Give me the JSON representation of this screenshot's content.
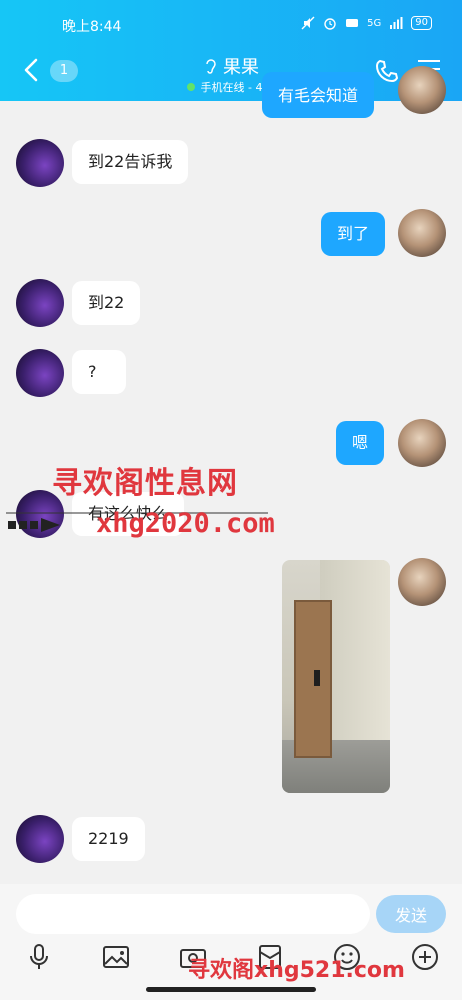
{
  "status_bar": {
    "time": "晚上8:44",
    "battery": "90",
    "network": "5G"
  },
  "header": {
    "unread_count": "1",
    "contact_name": "果果",
    "presence": "手机在线 - 4G",
    "presence_chevron": "›"
  },
  "messages": [
    {
      "side": "out",
      "text": "有毛会知道"
    },
    {
      "side": "in",
      "text": "到22告诉我"
    },
    {
      "side": "out",
      "text": "到了"
    },
    {
      "side": "in",
      "text": "到22"
    },
    {
      "side": "in",
      "text": "?"
    },
    {
      "side": "out",
      "text": "嗯"
    },
    {
      "side": "in",
      "text": "有这么快么"
    },
    {
      "side": "out",
      "type": "image",
      "alt": "photo"
    },
    {
      "side": "in",
      "text": "2219"
    }
  ],
  "watermarks": [
    "寻欢阁性息网",
    "xhg2020.com",
    "寻欢阁xhg521.com"
  ],
  "composer": {
    "placeholder": "",
    "send_label": "发送"
  },
  "toolbar": [
    "microphone-icon",
    "picture-icon",
    "camera-icon",
    "red-packet-icon",
    "emoji-icon",
    "plus-icon"
  ],
  "colors": {
    "header_start": "#16c6f6",
    "header_end": "#1aa6f5",
    "out_bubble": "#1ea7ff",
    "send_disabled": "#a7d5f7"
  }
}
